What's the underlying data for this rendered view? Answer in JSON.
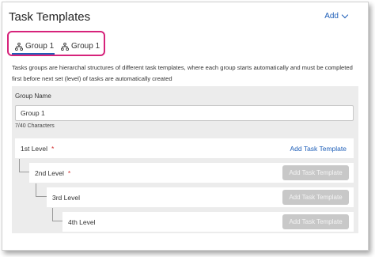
{
  "header": {
    "title": "Task Templates",
    "add_label": "Add"
  },
  "tabs": [
    {
      "label": "Group 1",
      "active": true,
      "icon": "hierarchy-icon"
    },
    {
      "label": "Group 1",
      "active": false,
      "icon": "hierarchy-icon"
    }
  ],
  "description": "Tasks groups are hierarchal structures of different task templates, where each group starts automatically and must be completed first before next set (level) of tasks are automatically created",
  "group": {
    "name_label": "Group Name",
    "name_value": "Group 1",
    "char_count": "7/40 Characters"
  },
  "levels": [
    {
      "label": "1st Level",
      "required": "*",
      "button": "Add Task Template",
      "enabled": true
    },
    {
      "label": "2nd Level",
      "required": "*",
      "button": "Add Task Template",
      "enabled": false
    },
    {
      "label": "3rd Level",
      "required": "",
      "button": "Add Task Template",
      "enabled": false
    },
    {
      "label": "4th Level",
      "required": "",
      "button": "Add Task Template",
      "enabled": false
    }
  ],
  "colors": {
    "accent": "#1f5fb8",
    "highlight": "#d6237b",
    "required": "#d32f2f",
    "disabled_button": "#c8c8c8"
  }
}
